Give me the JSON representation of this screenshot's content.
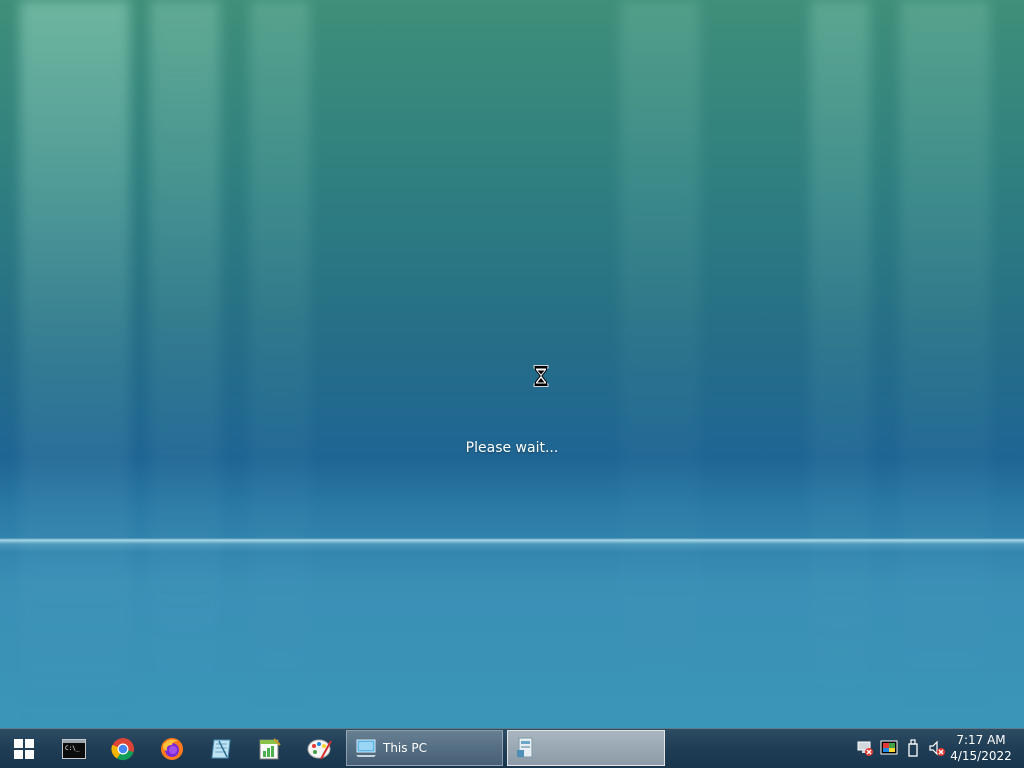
{
  "desktop": {
    "status_text": "Please wait..."
  },
  "taskbar": {
    "pinned": [
      {
        "name": "start-button-icon"
      },
      {
        "name": "command-prompt-icon"
      },
      {
        "name": "chrome-icon"
      },
      {
        "name": "firefox-icon"
      },
      {
        "name": "notepad-icon"
      },
      {
        "name": "spreadsheet-icon"
      },
      {
        "name": "paint-icon"
      }
    ],
    "windows": [
      {
        "label": "This PC",
        "icon": "computer-icon"
      },
      {
        "label": "",
        "icon": "application-icon",
        "active": true
      }
    ],
    "tray": {
      "icons": [
        "network-disconnected-icon",
        "display-color-icon",
        "usb-drive-icon",
        "volume-muted-icon"
      ],
      "time": "7:17 AM",
      "date": "4/15/2022"
    }
  },
  "colors": {
    "taskbar": "#1f3d55",
    "desktop_top": "#3f8f7a",
    "desktop_mid": "#1f6594",
    "desktop_bottom": "#3a96b8"
  }
}
